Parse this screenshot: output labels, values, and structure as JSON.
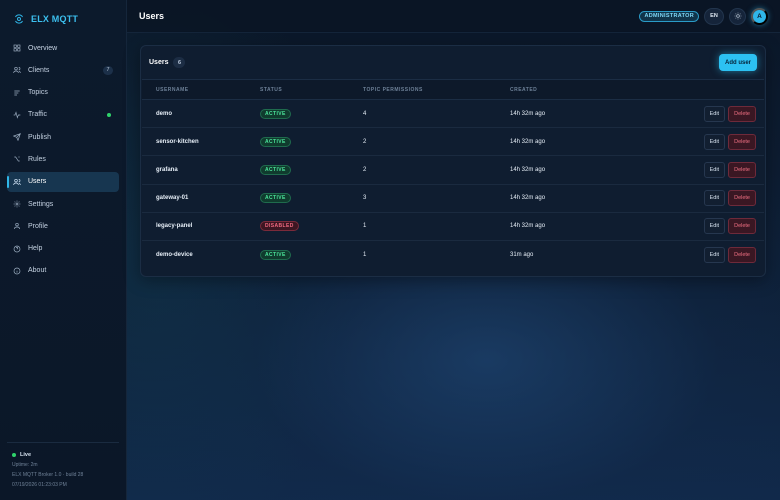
{
  "brand": {
    "name": "ELX MQTT",
    "logo_icon": "broker-logo-icon"
  },
  "sidebar": {
    "items": [
      {
        "label": "Overview",
        "icon": "overview-icon"
      },
      {
        "label": "Clients",
        "icon": "clients-icon",
        "badge": "7"
      },
      {
        "label": "Topics",
        "icon": "topics-icon"
      },
      {
        "label": "Traffic",
        "icon": "traffic-icon",
        "indicator": "online-dot"
      },
      {
        "label": "Publish",
        "icon": "publish-icon"
      },
      {
        "label": "Rules",
        "icon": "rules-icon"
      },
      {
        "label": "Users",
        "icon": "users-icon",
        "active": true
      },
      {
        "label": "Settings",
        "icon": "settings-icon"
      },
      {
        "label": "Profile",
        "icon": "profile-icon"
      },
      {
        "label": "Help",
        "icon": "help-icon"
      },
      {
        "label": "About",
        "icon": "about-icon"
      }
    ],
    "footer": {
      "status": "Live",
      "uptime": "Uptime: 2m",
      "version": "ELX MQTT Broker 1.0 · build 28",
      "timestamp": "07/19/2026 01:23:03 PM"
    }
  },
  "header": {
    "title": "Users",
    "role": "ADMINISTRATOR",
    "language": "EN",
    "theme_icon": "sun-icon",
    "avatar_initial": "A"
  },
  "users_card": {
    "title": "Users",
    "count": "6",
    "add_label": "Add user",
    "columns": [
      "USERNAME",
      "STATUS",
      "TOPIC PERMISSIONS",
      "CREATED"
    ],
    "edit_label": "Edit",
    "delete_label": "Delete",
    "rows": [
      {
        "username": "demo",
        "status": "ACTIVE",
        "permissions": "4",
        "created": "14h 32m ago"
      },
      {
        "username": "sensor-kitchen",
        "status": "ACTIVE",
        "permissions": "2",
        "created": "14h 32m ago"
      },
      {
        "username": "grafana",
        "status": "ACTIVE",
        "permissions": "2",
        "created": "14h 32m ago"
      },
      {
        "username": "gateway-01",
        "status": "ACTIVE",
        "permissions": "3",
        "created": "14h 32m ago"
      },
      {
        "username": "legacy-panel",
        "status": "DISABLED",
        "permissions": "1",
        "created": "14h 32m ago"
      },
      {
        "username": "demo-device",
        "status": "ACTIVE",
        "permissions": "1",
        "created": "31m ago"
      }
    ]
  },
  "colors": {
    "accent": "#2fb6e8",
    "active_status": "#4be39a",
    "disabled_status": "#f06a80",
    "live": "#2fd36b"
  }
}
